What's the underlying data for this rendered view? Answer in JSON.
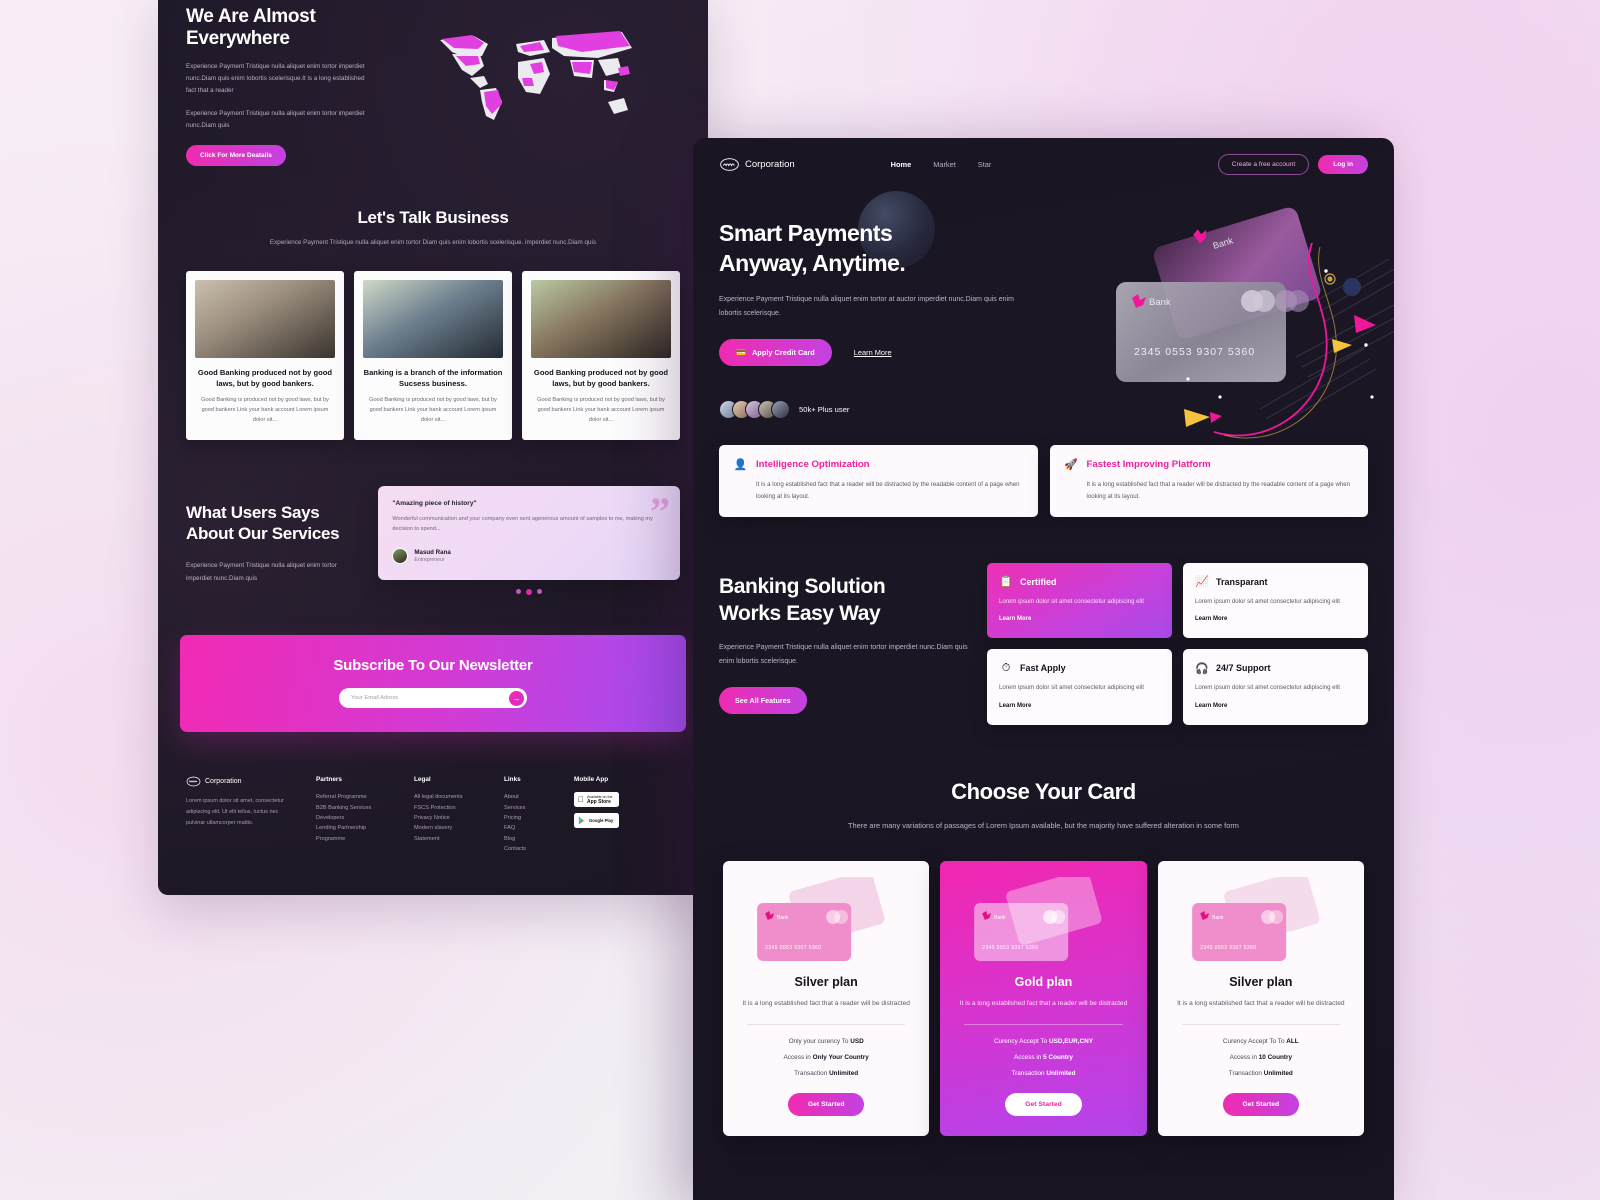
{
  "back_panel": {
    "everywhere": {
      "title": "We Are Almost Everywhere",
      "para1": "Experience Payment Tristique nulla aliquet enim tortor imperdiet nunc.Diam quis enim lobortis scelerisque.It is a long established fact that a reader",
      "para2": "Experience Payment Tristique nulla aliquet enim tortor imperdiet nunc.Diam quis",
      "cta": "Click For More Deatails"
    },
    "business": {
      "title": "Let's Talk Business",
      "subtitle": "Experience Payment Tristique nulla aliquet enim tortor Diam quis enim lobortis scelerisque. imperdiet nunc.Diam quis",
      "cards": [
        {
          "title": "Good Banking produced not by good laws, but by good bankers.",
          "body": "Good Banking is produced not by good laws, but by good bankers Link your bank account Lorem ipsum dolor sit..."
        },
        {
          "title": "Banking is a branch of the information Sucsess business.",
          "body": "Good Banking is produced not by good laws, but by good bankers Link your bank account Lorem ipsum dolor sit..."
        },
        {
          "title": "Good Banking produced not by good laws, but by good bankers.",
          "body": "Good Banking is produced not by good laws, but by good bankers Link your bank account Lorem ipsum dolor sit..."
        }
      ]
    },
    "testimonials": {
      "title": "What Users Says About Our Services",
      "subtitle": "Experience Payment Tristique nulla aliquet enim tortor imperdiet nunc.Diam quis",
      "quote_title": "\"Amazing piece of history\"",
      "quote_body": "Wonderful communication and your company even sent agenerous amount of samples to me, making my decision to spend...",
      "author_name": "Masud Rana",
      "author_role": "Entrepreneur"
    },
    "newsletter": {
      "title": "Subscribe To Our Newsletter",
      "placeholder": "Your Email Adress",
      "value": "",
      "submit_icon": "arrow-right-icon"
    },
    "footer": {
      "brand": "Corporation",
      "about": "Lorem ipsum dolor sit amet, consectetur adipiscing elit. Ut elit tellus, luctus nec pulvinar ullamcorper mattis.",
      "columns": [
        {
          "heading": "Partners",
          "links": [
            "Referral Programme",
            "B2B Banking Services",
            "Developers",
            "Lending Partnership",
            "Programme"
          ]
        },
        {
          "heading": "Legal",
          "links": [
            "All legal documents",
            "FSCS Protection",
            "Privacy Notice",
            "Modern slavery",
            "Statement"
          ]
        },
        {
          "heading": "Links",
          "links": [
            "About",
            "Services",
            "Pricing",
            "FAQ",
            "Blog",
            "Contacts"
          ]
        }
      ],
      "mobile_heading": "Mobile App",
      "stores": [
        {
          "small": "Available on the",
          "big": "App Store",
          "icon": "apple-icon"
        },
        {
          "small": "",
          "big": "Google Play",
          "icon": "google-play-icon"
        }
      ]
    }
  },
  "front_panel": {
    "nav": {
      "brand": "Corporation",
      "links": [
        "Home",
        "Market",
        "Star"
      ],
      "active": "Home",
      "create_account": "Create a free account",
      "login": "Log in"
    },
    "hero": {
      "title_line1": "Smart Payments",
      "title_line2": "Anyway, Anytime.",
      "paragraph": "Experience Payment Tristique nulla aliquet enim tortor at auctor imperdiet nunc.Diam quis enim lobortis scelerisque.",
      "apply_button": "Apply Credit Card",
      "learn_more": "Learn More",
      "users_count": "50k+ Plus user",
      "card_number": "2345 0553 9307 5360",
      "card_brand": "Bank"
    },
    "feature_cards": [
      {
        "icon": "brain-avatar-icon",
        "title": "Intelligence Optimization",
        "body": "It is a long established fact that a reader will be distracted by the readable content of a page when looking at its layout."
      },
      {
        "icon": "rocket-icon",
        "title": "Fastest Improving Platform",
        "body": "It is a long established fact that a reader will be distracted by the readable content of a page when looking at its layout."
      }
    ],
    "banking": {
      "title_line1": "Banking Solution",
      "title_line2": "Works Easy Way",
      "paragraph": "Experience Payment Tristique nulla aliquet enim tortor imperdiet nunc.Diam quis enim lobortis scelerisque.",
      "cta": "See All Features",
      "cards": [
        {
          "icon": "certificate-icon",
          "title": "Certified",
          "body": "Lorem ipsum dolor sit amet consectetur adipiscing elit",
          "link": "Learn More",
          "highlight": true
        },
        {
          "icon": "chart-up-icon",
          "title": "Transparant",
          "body": "Lorem ipsum dolor sit amet consectetur adipiscing elit",
          "link": "Learn More",
          "highlight": false
        },
        {
          "icon": "stopwatch-icon",
          "title": "Fast Apply",
          "body": "Lorem ipsum dolor sit amet consectetur adipiscing elit",
          "link": "Learn More",
          "highlight": false
        },
        {
          "icon": "headset-icon",
          "title": "24/7 Support",
          "body": "Lorem ipsum dolor sit amet consectetur adipiscing elit",
          "link": "Learn More",
          "highlight": false
        }
      ]
    },
    "choose": {
      "title": "Choose Your Card",
      "subtitle": "There are many variations of passages of Lorem Ipsum available, but the majority have suffered alteration in some form",
      "plans": [
        {
          "name": "Silver plan",
          "desc": "It is a long established fact that a reader will be distracted",
          "rows": [
            {
              "label": "Only your curency To ",
              "value": "USD"
            },
            {
              "label": "Access in ",
              "value": "Only Your Country"
            },
            {
              "label": "Transaction ",
              "value": "Unlimited"
            }
          ],
          "cta": "Get Started",
          "highlight": false
        },
        {
          "name": "Gold plan",
          "desc": "It is a long established fact that a reader will be distracted",
          "rows": [
            {
              "label": "Curency Accept To ",
              "value": "USD,EUR,CNY"
            },
            {
              "label": "Access in ",
              "value": "5 Country"
            },
            {
              "label": "Transaction ",
              "value": "Unlimited"
            }
          ],
          "cta": "Get Started",
          "highlight": true
        },
        {
          "name": "Silver plan",
          "desc": "It is a long established fact that a reader will be distracted",
          "rows": [
            {
              "label": "Curency Accept To To ",
              "value": "ALL"
            },
            {
              "label": "Access in ",
              "value": "10 Country"
            },
            {
              "label": "Transaction ",
              "value": "Unlimited"
            }
          ],
          "cta": "Get Started",
          "highlight": false
        }
      ],
      "card_number": "2345 0553 9307 5360",
      "card_brand": "Bank"
    }
  },
  "colors": {
    "accent_pink": "#f02bb0",
    "accent_purple": "#a24df0",
    "dark_bg": "#1a1522",
    "card_bg": "#fdf9fc"
  }
}
